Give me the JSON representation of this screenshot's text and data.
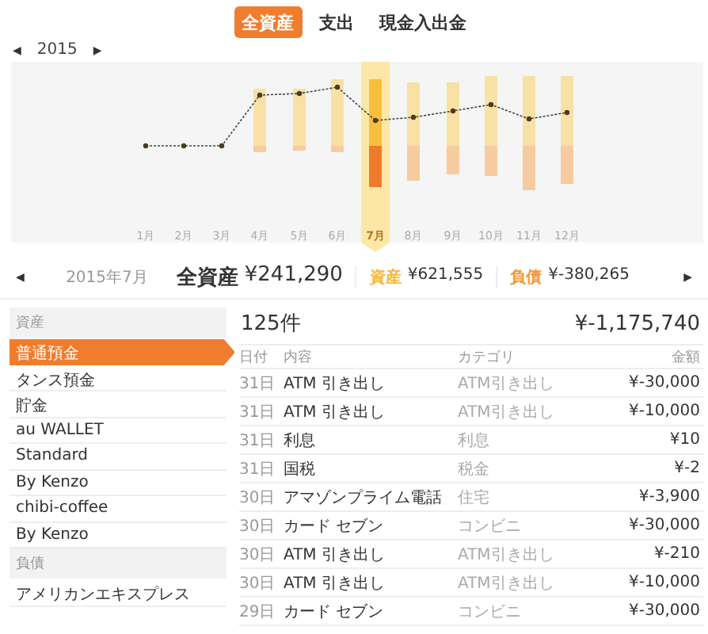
{
  "tabs": [
    {
      "label": "全資産",
      "selected": true
    },
    {
      "label": "支出",
      "selected": false
    },
    {
      "label": "現金入出金",
      "selected": false
    }
  ],
  "year_nav": {
    "prev": "◀",
    "year": "2015",
    "next": "▶"
  },
  "chart": {
    "months": [
      {
        "label": "1月",
        "selected": false
      },
      {
        "label": "2月",
        "selected": false
      },
      {
        "label": "3月",
        "selected": false
      },
      {
        "label": "4月",
        "selected": false
      },
      {
        "label": "5月",
        "selected": false
      },
      {
        "label": "6月",
        "selected": false
      },
      {
        "label": "7月",
        "selected": true
      },
      {
        "label": "8月",
        "selected": false
      },
      {
        "label": "9月",
        "selected": false
      },
      {
        "label": "10月",
        "selected": false
      },
      {
        "label": "11月",
        "selected": false
      },
      {
        "label": "12月",
        "selected": false
      }
    ]
  },
  "summary": {
    "prev": "◀",
    "date": "2015年7月",
    "items": [
      {
        "kind": "total",
        "label": "全資産",
        "value": "¥241,290"
      },
      {
        "kind": "asset",
        "label": "資産",
        "value": "¥621,555"
      },
      {
        "kind": "liability",
        "label": "負債",
        "value": "¥-380,265"
      }
    ],
    "next": "▶"
  },
  "sidebar": {
    "sections": [
      {
        "header": "資産",
        "items": [
          {
            "label": "普通預金",
            "selected": true
          },
          {
            "label": "タンス預金",
            "selected": false
          },
          {
            "label": "貯金",
            "selected": false
          },
          {
            "label": "au WALLET",
            "selected": false
          },
          {
            "label": "Standard",
            "selected": false
          },
          {
            "label": "By Kenzo",
            "selected": false
          },
          {
            "label": "chibi-coffee",
            "selected": false
          },
          {
            "label": "By Kenzo",
            "selected": false
          }
        ]
      },
      {
        "header": "負債",
        "items": [
          {
            "label": "アメリカンエキスプレス",
            "selected": false
          }
        ]
      }
    ]
  },
  "transactions": {
    "count": "125件",
    "total": "¥-1,175,740",
    "columns": [
      "日付",
      "内容",
      "カテゴリ",
      "金額"
    ],
    "rows": [
      [
        "31日",
        "ATM 引き出し",
        "ATM引き出し",
        "¥-30,000"
      ],
      [
        "31日",
        "ATM 引き出し",
        "ATM引き出し",
        "¥-10,000"
      ],
      [
        "31日",
        "利息",
        "利息",
        "¥10"
      ],
      [
        "31日",
        "国税",
        "税金",
        "¥-2"
      ],
      [
        "30日",
        "アマゾンプライム電話",
        "住宅",
        "¥-3,900"
      ],
      [
        "30日",
        "カード セブン",
        "コンビニ",
        "¥-30,000"
      ],
      [
        "30日",
        "ATM 引き出し",
        "ATM引き出し",
        "¥-210"
      ],
      [
        "30日",
        "ATM 引き出し",
        "ATM引き出し",
        "¥-10,000"
      ],
      [
        "29日",
        "カード セブン",
        "コンビニ",
        "¥-30,000"
      ]
    ]
  }
}
